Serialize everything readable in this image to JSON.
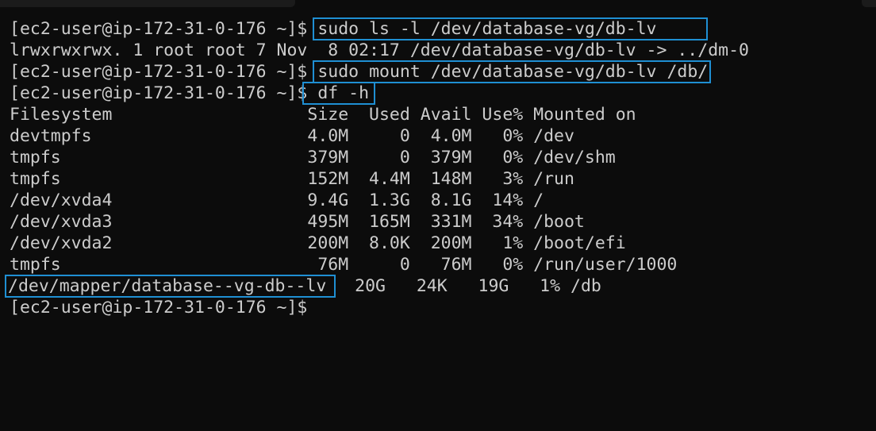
{
  "prompt": "[ec2-user@ip-172-31-0-176 ~]$",
  "commands": {
    "ls": "sudo ls -l /dev/database-vg/db-lv",
    "ls_output": "lrwxrwxrwx. 1 root root 7 Nov  8 02:17 /dev/database-vg/db-lv -> ../dm-0",
    "mount": "sudo mount /dev/database-vg/db-lv /db/",
    "df": "df -h"
  },
  "df_table": {
    "header": "Filesystem                   Size  Used Avail Use% Mounted on",
    "rows": [
      "devtmpfs                     4.0M     0  4.0M   0% /dev",
      "tmpfs                        379M     0  379M   0% /dev/shm",
      "tmpfs                        152M  4.4M  148M   3% /run",
      "/dev/xvda4                   9.4G  1.3G  8.1G  14% /",
      "/dev/xvda3                   495M  165M  331M  34% /boot",
      "/dev/xvda2                   200M  8.0K  200M   1% /boot/efi",
      "tmpfs                         76M     0   76M   0% /run/user/1000"
    ],
    "last_row": {
      "filesystem": "/dev/mapper/database--vg-db--lv",
      "rest": "  20G   24K   19G   1% /db"
    }
  },
  "colors": {
    "background": "#0c0c0c",
    "text": "#cccccc",
    "highlight": "#1f8fd3"
  }
}
